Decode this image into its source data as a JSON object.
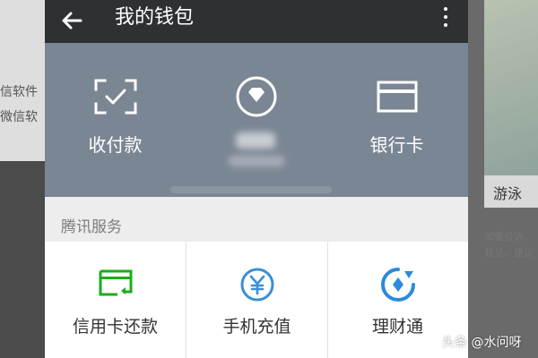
{
  "app": {
    "title": "我的钱包"
  },
  "wallet_actions": [
    {
      "label": "收付款",
      "icon": "scan-qr-icon"
    },
    {
      "label": "",
      "icon": "diamond-coin-icon"
    },
    {
      "label": "银行卡",
      "icon": "bank-card-icon"
    }
  ],
  "services": {
    "title": "腾讯服务",
    "items": [
      {
        "label": "信用卡还款",
        "icon": "credit-card-repay-icon",
        "color": "#1aad19"
      },
      {
        "label": "手机充值",
        "icon": "yuan-coin-icon",
        "color": "#3b8fd6"
      },
      {
        "label": "理财通",
        "icon": "licaitong-icon",
        "color": "#2e8ad8"
      }
    ]
  },
  "background": {
    "left_texts": [
      "信软件",
      "微信软"
    ],
    "right_caption": "游泳",
    "right_small": [
      "如要投诉、",
      "意见、建议"
    ]
  },
  "watermark": "头条 @水问呀",
  "colors": {
    "header": "#2e3134",
    "top_panel": "#7b8694",
    "page_bg": "#ededed"
  }
}
